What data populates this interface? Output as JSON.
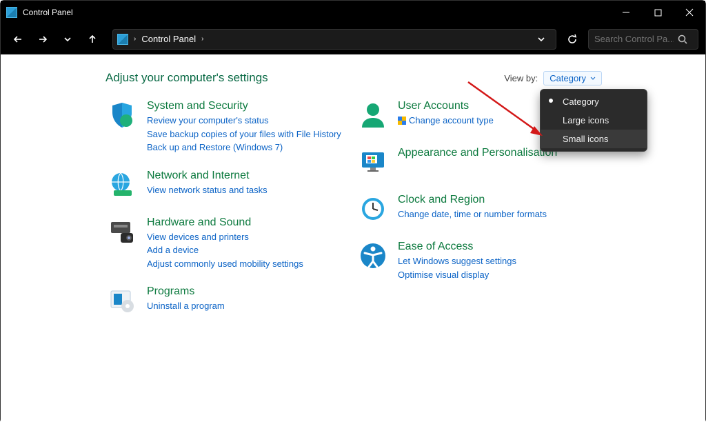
{
  "window": {
    "title": "Control Panel"
  },
  "breadcrumb": {
    "root": "Control Panel"
  },
  "search": {
    "placeholder": "Search Control Pa..."
  },
  "heading": "Adjust your computer's settings",
  "viewby": {
    "label": "View by:",
    "selected": "Category",
    "options": [
      "Category",
      "Large icons",
      "Small icons"
    ]
  },
  "left_categories": [
    {
      "title": "System and Security",
      "links": [
        "Review your computer's status",
        "Save backup copies of your files with File History",
        "Back up and Restore (Windows 7)"
      ]
    },
    {
      "title": "Network and Internet",
      "links": [
        "View network status and tasks"
      ]
    },
    {
      "title": "Hardware and Sound",
      "links": [
        "View devices and printers",
        "Add a device",
        "Adjust commonly used mobility settings"
      ]
    },
    {
      "title": "Programs",
      "links": [
        "Uninstall a program"
      ]
    }
  ],
  "right_categories": [
    {
      "title": "User Accounts",
      "links": [
        "Change account type"
      ],
      "shield_on_first": true
    },
    {
      "title": "Appearance and Personalisation",
      "links": []
    },
    {
      "title": "Clock and Region",
      "links": [
        "Change date, time or number formats"
      ]
    },
    {
      "title": "Ease of Access",
      "links": [
        "Let Windows suggest settings",
        "Optimise visual display"
      ]
    }
  ]
}
